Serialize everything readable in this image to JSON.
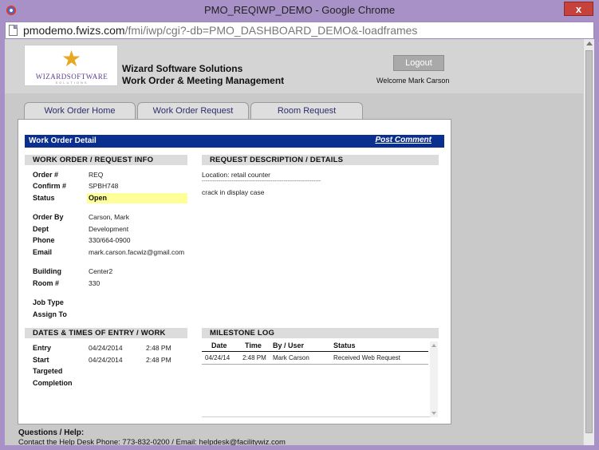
{
  "window": {
    "title": "PMO_REQIWP_DEMO - Google Chrome",
    "close_glyph": "x",
    "url_host": "pmodemo.fwizs.com",
    "url_path": "/fmi/iwp/cgi?-db=PMO_DASHBOARD_DEMO&-loadframes"
  },
  "header": {
    "logo_text": "WIZARDSOFTWARE",
    "logo_subtext": "SOLUTIONS",
    "company_name": "Wizard Software Solutions",
    "company_subtitle": "Work Order & Meeting Management",
    "logout_label": "Logout",
    "welcome": "Welcome Mark Carson"
  },
  "tabs": [
    {
      "label": "Work Order Home"
    },
    {
      "label": "Work Order Request"
    },
    {
      "label": "Room Request"
    }
  ],
  "detail": {
    "title": "Work Order Detail",
    "post_comment": "Post Comment"
  },
  "work_order": {
    "heading": "WORK ORDER / REQUEST INFO",
    "order_label": "Order #",
    "order_value": "REQ",
    "confirm_label": "Confirm #",
    "confirm_value": "SPBH748",
    "status_label": "Status",
    "status_value": "Open",
    "order_by_label": "Order By",
    "order_by_value": "Carson, Mark",
    "dept_label": "Dept",
    "dept_value": "Development",
    "phone_label": "Phone",
    "phone_value": "330/664-0900",
    "email_label": "Email",
    "email_value": "mark.carson.facwiz@gmail.com",
    "building_label": "Building",
    "building_value": "Center2",
    "room_label": "Room #",
    "room_value": "330",
    "job_type_label": "Job Type",
    "assign_to_label": "Assign To"
  },
  "request": {
    "heading": "REQUEST DESCRIPTION / DETAILS",
    "location": "Location: retail counter",
    "separator": "----------------------------------------------------------------",
    "description": "crack in display case"
  },
  "dates": {
    "heading": "DATES & TIMES OF ENTRY / WORK",
    "entry_label": "Entry",
    "entry_date": "04/24/2014",
    "entry_time": "2:48 PM",
    "start_label": "Start",
    "start_date": "04/24/2014",
    "start_time": "2:48 PM",
    "targeted_label": "Targeted",
    "completion_label": "Completion"
  },
  "milestone": {
    "heading": "MILESTONE LOG",
    "columns": [
      "Date",
      "Time",
      "By / User",
      "Status"
    ],
    "rows": [
      {
        "date": "04/24/14",
        "time": "2:48 PM",
        "user": "Mark Carson",
        "status": "Received Web Request"
      }
    ]
  },
  "footer": {
    "questions": "Questions / Help:",
    "contact": "Contact the Help Desk   Phone: 773-832-0200   /   Email: helpdesk@facilitywiz.com"
  }
}
